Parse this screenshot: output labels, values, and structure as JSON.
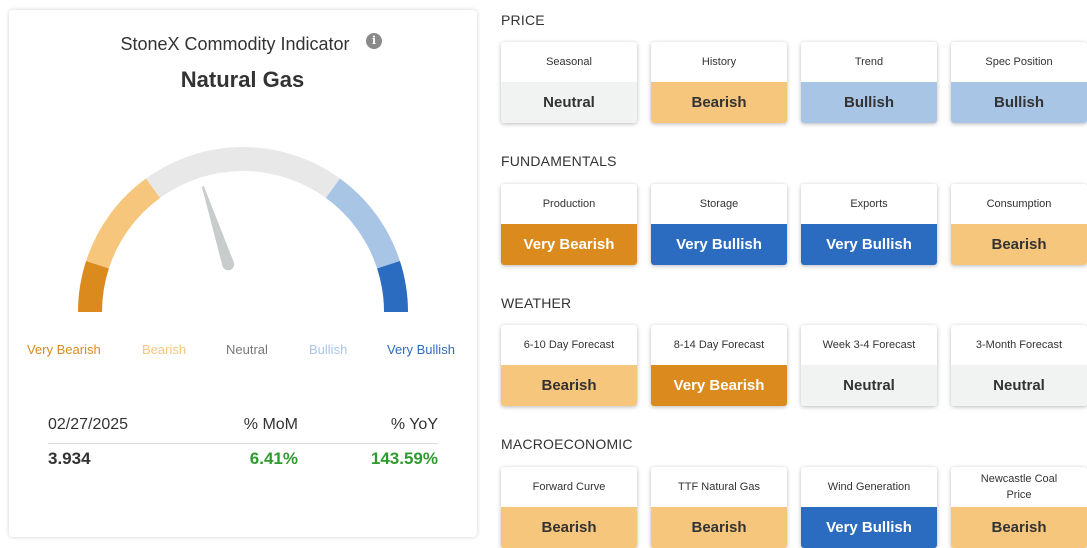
{
  "indicator": {
    "title": "StoneX Commodity Indicator",
    "commodity": "Natural Gas",
    "info_icon": "info-icon",
    "gauge_level": "Neutral",
    "gauge_labels": [
      "Very Bearish",
      "Bearish",
      "Neutral",
      "Bullish",
      "Very Bullish"
    ],
    "colors": {
      "very_bearish": "#db8b1e",
      "bearish": "#f6c67c",
      "neutral": "#e8e8e8",
      "bullish": "#a9c5e6",
      "very_bullish": "#2c6cc0",
      "needle": "#c9cccc"
    },
    "stats": {
      "date": "02/27/2025",
      "mom_header": "% MoM",
      "yoy_header": "% YoY",
      "price": "3.934",
      "mom": "6.41%",
      "yoy": "143.59%",
      "positive_color": "#2f9a2f"
    }
  },
  "sections": [
    {
      "title": "PRICE",
      "tiles": [
        {
          "label": "Seasonal",
          "value": "Neutral"
        },
        {
          "label": "History",
          "value": "Bearish"
        },
        {
          "label": "Trend",
          "value": "Bullish"
        },
        {
          "label": "Spec Position",
          "value": "Bullish"
        }
      ]
    },
    {
      "title": "FUNDAMENTALS",
      "tiles": [
        {
          "label": "Production",
          "value": "Very Bearish"
        },
        {
          "label": "Storage",
          "value": "Very Bullish"
        },
        {
          "label": "Exports",
          "value": "Very Bullish"
        },
        {
          "label": "Consumption",
          "value": "Bearish"
        }
      ]
    },
    {
      "title": "WEATHER",
      "tiles": [
        {
          "label": "6-10 Day Forecast",
          "value": "Bearish"
        },
        {
          "label": "8-14 Day Forecast",
          "value": "Very Bearish"
        },
        {
          "label": "Week 3-4 Forecast",
          "value": "Neutral"
        },
        {
          "label": "3-Month Forecast",
          "value": "Neutral"
        }
      ]
    },
    {
      "title": "MACROECONOMIC",
      "tiles": [
        {
          "label": "Forward Curve",
          "value": "Bearish"
        },
        {
          "label": "TTF Natural Gas",
          "value": "Bearish"
        },
        {
          "label": "Wind Generation",
          "value": "Very Bullish"
        },
        {
          "label": "Newcastle Coal Price",
          "value": "Bearish"
        }
      ]
    }
  ]
}
